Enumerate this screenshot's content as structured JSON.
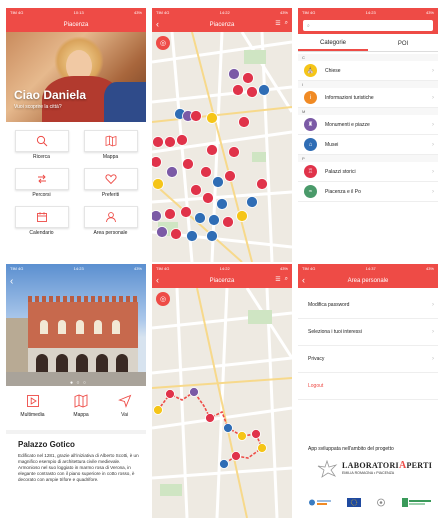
{
  "status": {
    "carrier": "TIM 4G",
    "battery": "43%",
    "screens": [
      "10:13",
      "14:22",
      "14:23",
      "14:23",
      "14:22",
      "14:37"
    ]
  },
  "home": {
    "title": "Piacenza",
    "greeting": "Ciao Daniela",
    "subtitle": "Vuoi scoprire la città?",
    "tiles": [
      {
        "label": "Ricerca",
        "icon": "search-icon"
      },
      {
        "label": "Mappa",
        "icon": "map-icon"
      },
      {
        "label": "Percorsi",
        "icon": "routes-icon"
      },
      {
        "label": "Preferiti",
        "icon": "heart-icon"
      },
      {
        "label": "Calendario",
        "icon": "calendar-icon"
      },
      {
        "label": "Area personale",
        "icon": "user-icon"
      }
    ]
  },
  "map1": {
    "title": "Piacenza"
  },
  "search": {
    "placeholder": "",
    "tabs": [
      "Categorie",
      "POI"
    ],
    "sections": [
      {
        "letter": "C",
        "items": [
          {
            "label": "Chiese",
            "icon": "church-icon",
            "color": "#f5c518"
          }
        ]
      },
      {
        "letter": "I",
        "items": [
          {
            "label": "Informazioni turistiche",
            "icon": "info-icon",
            "color": "#f08a24"
          }
        ]
      },
      {
        "letter": "M",
        "items": [
          {
            "label": "Monumenti e piazze",
            "icon": "monument-icon",
            "color": "#7b5aa6"
          },
          {
            "label": "Musei",
            "icon": "museum-icon",
            "color": "#2f6db5"
          }
        ]
      },
      {
        "letter": "P",
        "items": [
          {
            "label": "Palazzi storici",
            "icon": "palace-icon",
            "color": "#e0334a"
          },
          {
            "label": "Piacenza e il Po",
            "icon": "river-icon",
            "color": "#4a9a6a"
          }
        ]
      }
    ]
  },
  "detail": {
    "actions": [
      {
        "label": "Multimedia",
        "icon": "play-icon"
      },
      {
        "label": "Mappa",
        "icon": "map-icon"
      },
      {
        "label": "Vai",
        "icon": "navigate-icon"
      }
    ],
    "title": "Palazzo Gotico",
    "description": "Edificato nel 1281, grazie all'iniziativa di Alberto Scotti, è un magnifico esempio di architettura civile medievale. Armonioso nel suo loggiato in marmo rosa di Verona, in elegante contrasto con il piano superiore in cotto rosso, è decorato con ampie trifore e quadrifore."
  },
  "map2": {
    "title": "Piacenza"
  },
  "account": {
    "title": "Area personale",
    "items": [
      {
        "label": "Modifica password"
      },
      {
        "label": "Seleziona i tuoi interessi"
      },
      {
        "label": "Privacy"
      },
      {
        "label": "Logout"
      }
    ],
    "credit": "App sviluppata nell'ambito del progetto",
    "lab_name_pre": "L",
    "lab_name_mid": "ABORATORI",
    "lab_name_a": "A",
    "lab_name_post": "PERTI",
    "lab_sub": "EMILIA ROMAGNA • PIACENZA"
  },
  "colors": {
    "accent": "#ee4b46",
    "map_bg": "#eeeae2",
    "route": "#ee4b46"
  }
}
